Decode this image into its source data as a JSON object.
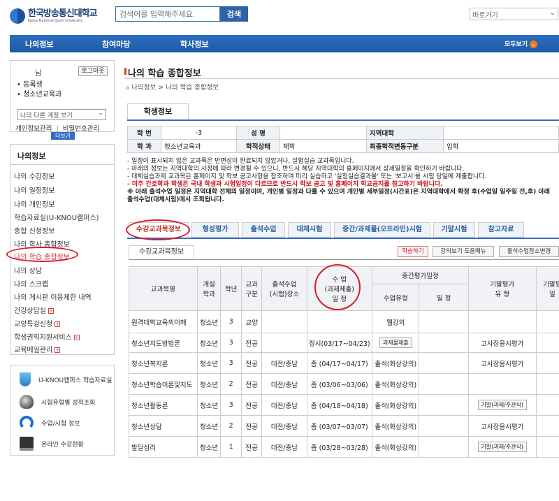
{
  "header": {
    "logo_ko": "한국방송통신대학교",
    "logo_en": "Korea National Open University",
    "search_placeholder": "검색어를 입력해주세요.",
    "search_button": "검색",
    "shortcut_select": "바로가기"
  },
  "gnb": {
    "items": [
      "나의정보",
      "참여마당",
      "학사정보"
    ],
    "all_menu": "모두보기",
    "all_icon": "chevron-down-icon"
  },
  "user": {
    "name_suffix": "님",
    "logout": "로그아웃",
    "status": "등록생",
    "dept": "청소년교육과",
    "other_account": "나의 다른 계정 보기",
    "account_manage": "개인정보관리",
    "separator": "|",
    "password_change": "비밀번호관리",
    "more": "더보기"
  },
  "nav": {
    "title": "나의정보",
    "items": [
      {
        "label": "나의 수강정보",
        "plus": false
      },
      {
        "label": "나의 일정정보",
        "plus": false
      },
      {
        "label": "나의 개인정보",
        "plus": false
      },
      {
        "label": "학습자료실(U-KNOU캠퍼스)",
        "plus": false
      },
      {
        "label": "종합 신청정보",
        "plus": false
      },
      {
        "label": "나의 학사 종합정보",
        "plus": false
      },
      {
        "label": "나의 학습 종합정보",
        "plus": false,
        "active": true
      },
      {
        "label": "나의 상담",
        "plus": false
      },
      {
        "label": "나의 스크랩",
        "plus": false
      },
      {
        "label": "나의 게시판 이용제한 내역",
        "plus": false
      },
      {
        "label": "건강상담실",
        "plus": true
      },
      {
        "label": "교양특강신청",
        "plus": true
      },
      {
        "label": "학생권익지원서비스",
        "plus": true
      },
      {
        "label": "교육메일관리",
        "plus": true
      }
    ]
  },
  "quick": [
    {
      "label": "U-KNOU캠퍼스 학습자료실",
      "icon": "u-knou-icon"
    },
    {
      "label": "시험유형별 성적조회",
      "icon": "mouse-icon"
    },
    {
      "label": "수업/시험 정보",
      "icon": "headset-icon"
    },
    {
      "label": "온라인 수강현황",
      "icon": "monitor-icon"
    }
  ],
  "main": {
    "title": "나의 학습 종합정보",
    "breadcrumb": [
      "나의정보",
      "나의 학습 종합정보"
    ],
    "student_tab": "학생정보",
    "info": {
      "id_label": "학 번",
      "id_value": "-3",
      "name_label": "성 명",
      "name_value": "",
      "region_label": "지역대학",
      "region_value": "",
      "dept_label": "학 과",
      "dept_value": "청소년교육과",
      "status_label": "학적상태",
      "status_value": "재학",
      "change_label": "최종학적변동구분",
      "change_value": "입학"
    },
    "notices": [
      {
        "text": "- 일정이 표시되지 않은 교과목은 반편성이 완료되지 않았거나, 실험실습 교과목입니다.",
        "style": "normal"
      },
      {
        "text": "- 아래의 정보는 지역대학의 사정에 따라 변경될 수 있으니, 반드시 해당 지역대학의 홈페이지에서 상세일정을 확인하기 바랍니다.",
        "style": "normal"
      },
      {
        "text": "- 대체실습과제 교과목은 홈페이지 및 학보 공고사항을 참조하여 미리 실습하고 '실험실습결과물' 또는 '보고서'를 시험 당일에 제출합니다.",
        "style": "normal"
      },
      {
        "text": "- 미주 간호학과 학생은 국내 학생과 시험일정이 다르므로 반드시 학보 공고 및 홈페이지 학교공지를 참고하기 바랍니다.",
        "style": "red"
      },
      {
        "text": "※ 아래 출석수업 일정은 지역대학 전체의 일정이며, 개인별 일정과 다를 수 있으며 개인별 세부일정(시간표)은 지역대학에서 확정 후(수업일 일주일 전,후) 아래 출석수업(대체시험)에서 조회됩니다.",
        "style": "bold"
      }
    ],
    "tabs": [
      "수강교과목정보",
      "형성평가",
      "출석수업",
      "대체시험",
      "중간/과제물(오프라인)시험",
      "기말시험",
      "참고자료"
    ],
    "subtab": "수강교과목정보",
    "buttons": {
      "study": "학습하기",
      "lecture_help": "강의보기 도움메뉴",
      "attend_change": "출석수업장소변경"
    },
    "table_head": {
      "course": "교과목명",
      "dept": "개설\n학과",
      "year": "학년",
      "type": "교과\n구분",
      "place": "출석수업\n(시험)장소",
      "sched_a": "수 업",
      "sched_b": "(과제제출)",
      "sched_c": "일 정",
      "midterm": "중간평가일정",
      "mid_type": "수업유형",
      "mid_date": "일 정",
      "final_eval": "기말평가\n유 형",
      "final_date": "기말평\n일"
    },
    "rows": [
      {
        "course": "원격대학교육의이해",
        "dept": "청소년",
        "year": "3",
        "type": "교양",
        "place": "",
        "schedule": "",
        "mid_type": "웹강의",
        "mid_btn": "",
        "final_eval": "",
        "final_btn": ""
      },
      {
        "course": "청소년지도방법론",
        "dept": "청소년",
        "year": "3",
        "type": "전공",
        "place": "",
        "schedule": "정시(03/17~04/23)",
        "mid_type": "",
        "mid_btn": "과제물제출",
        "final_eval": "고사장응시평가",
        "final_btn": ""
      },
      {
        "course": "청소년복지론",
        "dept": "청소년",
        "year": "3",
        "type": "전공",
        "place": "대전/충남",
        "schedule": "좀 (04/17~04/17)",
        "mid_type": "출석(화상강의)",
        "mid_btn": "",
        "final_eval": "고사장응시평가",
        "final_btn": ""
      },
      {
        "course": "청소년학습이론및지도",
        "dept": "청소년",
        "year": "2",
        "type": "전공",
        "place": "대전/충남",
        "schedule": "좀 (03/06~03/06)",
        "mid_type": "출석(화상강의)",
        "mid_btn": "",
        "final_eval": "",
        "final_btn": ""
      },
      {
        "course": "청소년활동론",
        "dept": "청소년",
        "year": "3",
        "type": "전공",
        "place": "대전/충남",
        "schedule": "좀 (04/18~04/18)",
        "mid_type": "출석(화상강의)",
        "mid_btn": "",
        "final_eval": "",
        "final_btn": "기말(과제/주관식)"
      },
      {
        "course": "청소년상담",
        "dept": "청소년",
        "year": "2",
        "type": "전공",
        "place": "대전/충남",
        "schedule": "좀 (03/07~03/07)",
        "mid_type": "출석(화상강의)",
        "mid_btn": "",
        "final_eval": "고사장응시평가",
        "final_btn": ""
      },
      {
        "course": "발달심리",
        "dept": "청소년",
        "year": "1",
        "type": "전공",
        "place": "대전/충남",
        "schedule": "좀 (03/28~03/28)",
        "mid_type": "출석(화상강의)",
        "mid_btn": "",
        "final_eval": "",
        "final_btn": "기말(과제/주관식)"
      }
    ]
  }
}
